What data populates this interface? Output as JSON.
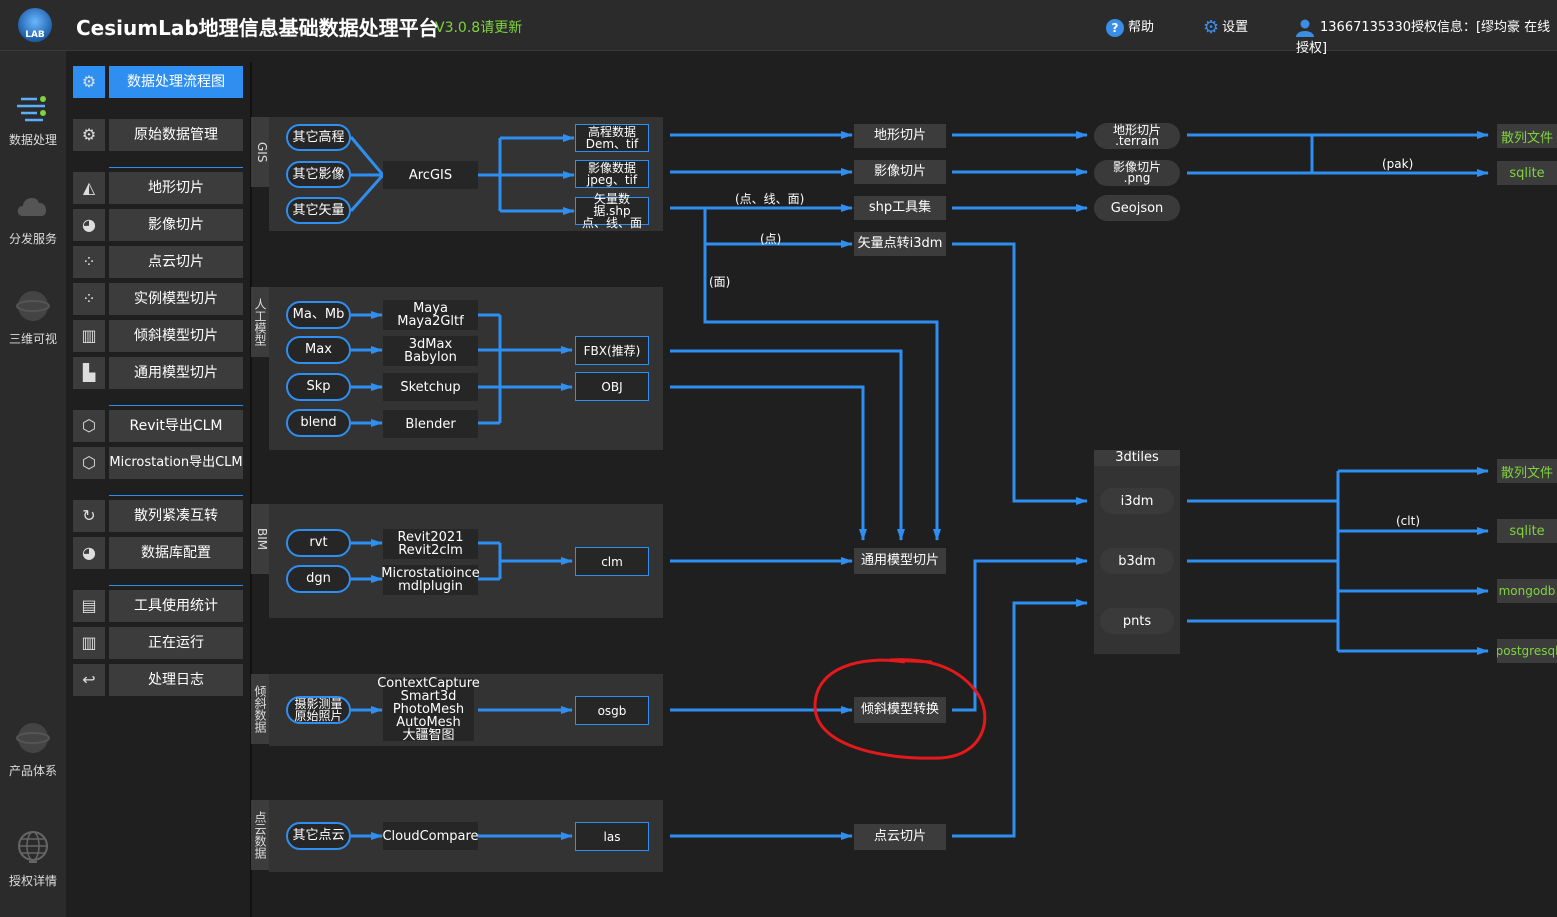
{
  "app": {
    "title": "CesiumLab地理信息基础数据处理平台",
    "version": "V3.0.8请更新",
    "logo_text": "LAB",
    "help": "帮助",
    "settings": "设置",
    "user": "13667135330授权信息：[缪均豪 在线授权]",
    "accent": "#2f8ff0",
    "green": "#7fd43c"
  },
  "rail": [
    {
      "label": "数据处理",
      "icon": "data-flow-icon"
    },
    {
      "label": "分发服务",
      "icon": "cloud-icon"
    },
    {
      "label": "三维可视",
      "icon": "globe-icon"
    },
    {
      "label": "产品体系",
      "icon": "globe-icon"
    },
    {
      "label": "授权详情",
      "icon": "globe-grid-icon"
    }
  ],
  "menu": [
    {
      "label": "数据处理流程图",
      "icon": "⚙"
    },
    {
      "label": "原始数据管理",
      "icon": "⚙"
    },
    {
      "label": "地形切片",
      "icon": "◭"
    },
    {
      "label": "影像切片",
      "icon": "◕"
    },
    {
      "label": "点云切片",
      "icon": "⁘"
    },
    {
      "label": "实例模型切片",
      "icon": "⁘"
    },
    {
      "label": "倾斜模型切片",
      "icon": "▥"
    },
    {
      "label": "通用模型切片",
      "icon": "▙"
    },
    {
      "label": "Revit导出CLM",
      "icon": "⬡"
    },
    {
      "label": "Microstation导出CLM",
      "icon": "⬡"
    },
    {
      "label": "散列紧凑互转",
      "icon": "↻"
    },
    {
      "label": "数据库配置",
      "icon": "◕"
    },
    {
      "label": "工具使用统计",
      "icon": "▤"
    },
    {
      "label": "正在运行",
      "icon": "▥"
    },
    {
      "label": "处理日志",
      "icon": "↩"
    }
  ],
  "groups": {
    "gis": "GIS",
    "manual": "人工模型",
    "bim": "BIM",
    "oblique": "倾斜数据",
    "pointcloud": "点云数据"
  },
  "gis": {
    "inputs": [
      "其它高程",
      "其它影像",
      "其它矢量"
    ],
    "tool": "ArcGIS",
    "outputs": [
      "高程数据\nDem、tif",
      "影像数据\njpeg、tif",
      "矢量数据.shp\n点、线、面"
    ]
  },
  "manual": {
    "inputs": [
      "Ma、Mb",
      "Max",
      "Skp",
      "blend"
    ],
    "tools": [
      "Maya\nMaya2Gltf",
      "3dMax\nBabylon",
      "Sketchup",
      "Blender"
    ],
    "outputs": [
      "FBX(推荐)",
      "OBJ"
    ]
  },
  "bim": {
    "inputs": [
      "rvt",
      "dgn"
    ],
    "tools": [
      "Revit2021\nRevit2clm",
      "Microstatioince\nmdlplugin"
    ],
    "output": "clm"
  },
  "oblique": {
    "input": "摄影测量\n原始照片",
    "tool": "ContextCapture\nSmart3d\nPhotoMesh\nAutoMesh\n大疆智图",
    "output": "osgb"
  },
  "pointcloud": {
    "input": "其它点云",
    "tool": "CloudCompare",
    "output": "las"
  },
  "process": {
    "terrain": "地形切片",
    "imagery": "影像切片",
    "shp": "shp工具集",
    "vec_i3dm": "矢量点转i3dm",
    "general": "通用模型切片",
    "oblique": "倾斜模型转换",
    "pointcloud": "点云切片"
  },
  "results": {
    "terrain": "地形切片\n.terrain",
    "imagery": "影像切片\n.png",
    "geojson": "Geojson",
    "tiles_title": "3dtiles",
    "i3dm": "i3dm",
    "b3dm": "b3dm",
    "pnts": "pnts"
  },
  "edges": {
    "plt": "(点、线、面)",
    "pt": "(点)",
    "face": "(面)",
    "pak": "(pak)",
    "clt": "(clt)"
  },
  "storage": {
    "top": [
      "散列文件",
      "sqlite"
    ],
    "bottom": [
      "散列文件",
      "sqlite",
      "mongodb",
      "postgresql"
    ]
  }
}
